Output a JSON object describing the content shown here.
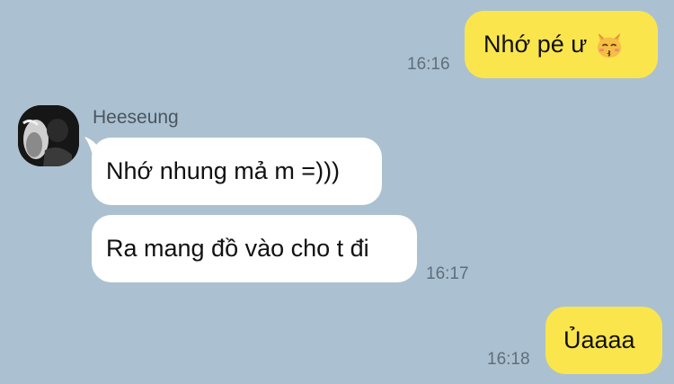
{
  "chat": {
    "messages": [
      {
        "direction": "outgoing",
        "text": "Nhớ pé ư",
        "emoji": "kissing-cat-face-icon",
        "time": "16:16"
      },
      {
        "direction": "incoming",
        "sender": "Heeseung",
        "text": "Nhớ nhung mả m =)))"
      },
      {
        "direction": "incoming",
        "text": "Ra mang đồ vào cho t đi",
        "time": "16:17"
      },
      {
        "direction": "outgoing",
        "text": "Ủaaaa",
        "time": "16:18"
      }
    ]
  },
  "colors": {
    "background": "#abc1d1",
    "outgoing_bubble": "#fbe54d",
    "incoming_bubble": "#ffffff",
    "timestamp": "#5f6e7a"
  }
}
